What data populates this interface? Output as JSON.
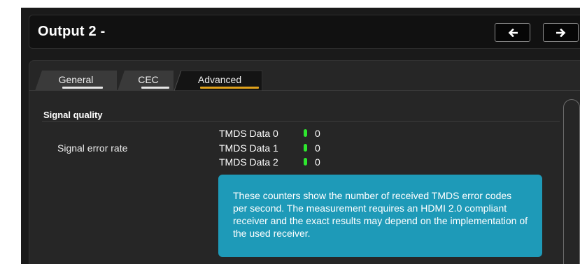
{
  "header": {
    "title": "Output 2 -",
    "prev_button": "arrow-left-icon",
    "next_button": "arrow-right-icon"
  },
  "tabs": [
    {
      "label": "General",
      "active": false,
      "indicator_color": "#e6e6e6"
    },
    {
      "label": "CEC",
      "active": false,
      "indicator_color": "#e6e6e6"
    },
    {
      "label": "Advanced",
      "active": true,
      "indicator_color": "#e0a21c"
    }
  ],
  "signal_quality": {
    "section_title": "Signal quality",
    "row_label": "Signal error rate",
    "counters": [
      {
        "name": "TMDS Data 0",
        "value": "0",
        "status_color": "#2ee62e"
      },
      {
        "name": "TMDS Data 1",
        "value": "0",
        "status_color": "#2ee62e"
      },
      {
        "name": "TMDS Data 2",
        "value": "0",
        "status_color": "#2ee62e"
      }
    ],
    "info_text": "These counters show the number of received TMDS error codes per second. The measurement requires an HDMI 2.0 compliant receiver and the exact results may depend on the implementation of the used receiver."
  },
  "colors": {
    "background": "#1a1a1a",
    "panel": "#262626",
    "info_box": "#1e9ab8",
    "accent": "#e0a21c",
    "status_ok": "#2ee62e"
  }
}
